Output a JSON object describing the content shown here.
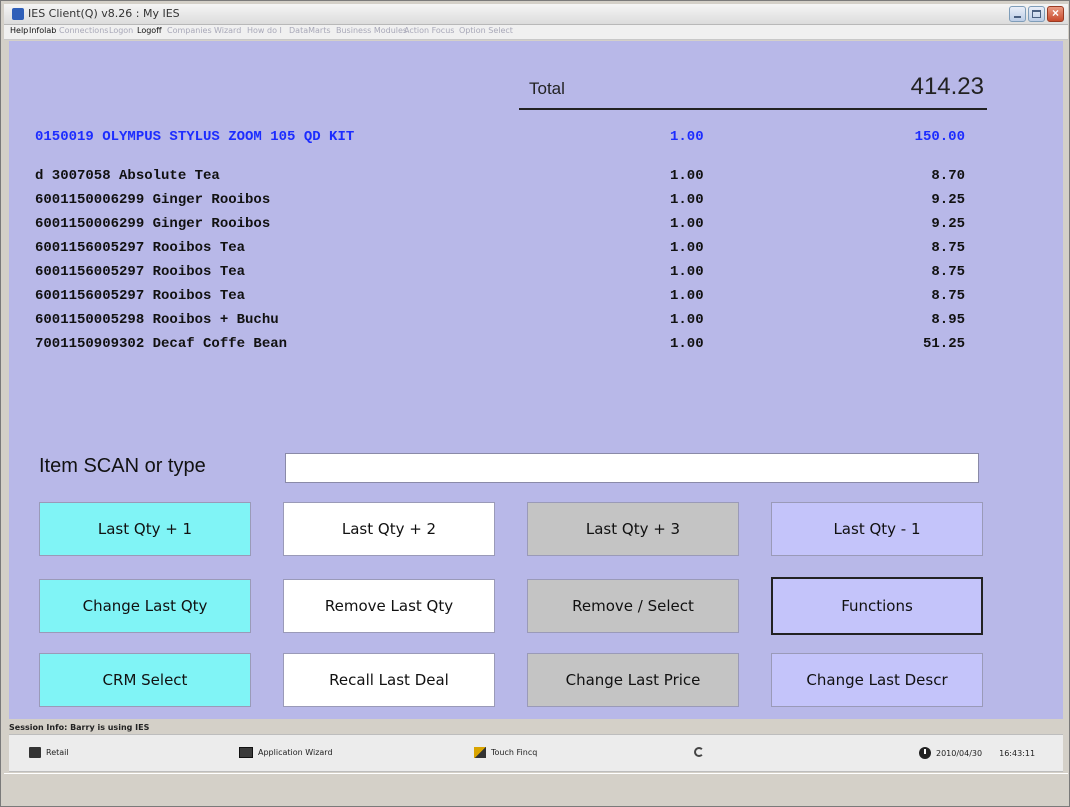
{
  "window": {
    "title": "IES Client(Q) v8.26 : My IES"
  },
  "menu": [
    {
      "label": "Help",
      "enabled": true
    },
    {
      "label": "Infolab",
      "enabled": true
    },
    {
      "label": "Connections",
      "enabled": false
    },
    {
      "label": "Logon",
      "enabled": false
    },
    {
      "label": "Logoff",
      "enabled": true
    },
    {
      "label": "Companies",
      "enabled": false
    },
    {
      "label": "Wizard",
      "enabled": false
    },
    {
      "label": "How do I",
      "enabled": false
    },
    {
      "label": "DataMarts",
      "enabled": false
    },
    {
      "label": "Business Modules",
      "enabled": false
    },
    {
      "label": "Action Focus",
      "enabled": false
    },
    {
      "label": "Option Select",
      "enabled": false
    }
  ],
  "pos": {
    "total_label": "Total",
    "total_value": "414.23",
    "lines": [
      {
        "desc": "0150019 OLYMPUS STYLUS ZOOM 105 QD KIT",
        "qty": "1.00",
        "amount": "150.00",
        "highlight": true
      },
      {
        "desc": "d 3007058 Absolute Tea",
        "qty": "1.00",
        "amount": "8.70"
      },
      {
        "desc": "6001150006299 Ginger Rooibos",
        "qty": "1.00",
        "amount": "9.25"
      },
      {
        "desc": "6001150006299 Ginger Rooibos",
        "qty": "1.00",
        "amount": "9.25"
      },
      {
        "desc": "6001156005297 Rooibos Tea",
        "qty": "1.00",
        "amount": "8.75"
      },
      {
        "desc": "6001156005297 Rooibos Tea",
        "qty": "1.00",
        "amount": "8.75"
      },
      {
        "desc": "6001156005297 Rooibos Tea",
        "qty": "1.00",
        "amount": "8.75"
      },
      {
        "desc": "6001150005298 Rooibos + Buchu",
        "qty": "1.00",
        "amount": "8.95"
      },
      {
        "desc": "7001150909302 Decaf Coffe Bean",
        "qty": "1.00",
        "amount": "51.25"
      }
    ],
    "scan_label": "Item SCAN or type",
    "scan_value": ""
  },
  "buttons": [
    {
      "label": "Last Qty + 1",
      "color": "cyan"
    },
    {
      "label": "Last Qty + 2",
      "color": "white"
    },
    {
      "label": "Last Qty + 3",
      "color": "gray"
    },
    {
      "label": "Last Qty - 1",
      "color": "lavender"
    },
    {
      "label": "Change Last Qty",
      "color": "cyan"
    },
    {
      "label": "Remove Last Qty",
      "color": "white"
    },
    {
      "label": "Remove / Select",
      "color": "gray"
    },
    {
      "label": "Functions",
      "color": "lavender"
    },
    {
      "label": "CRM Select",
      "color": "cyan"
    },
    {
      "label": "Recall Last Deal",
      "color": "white"
    },
    {
      "label": "Change Last Price",
      "color": "gray"
    },
    {
      "label": "Change Last Descr",
      "color": "lavender"
    }
  ],
  "status": {
    "session": "Session Info: Barry is using IES",
    "taskbar": [
      {
        "label": "Retail",
        "icon": "retail-icon"
      },
      {
        "label": "Application Wizard",
        "icon": "wizard-icon"
      },
      {
        "label": "Touch Fincq",
        "icon": "touch-icon"
      }
    ],
    "date": "2010/04/30",
    "time": "16:43:11"
  },
  "colors": {
    "panel": "#b8b8e8",
    "highlight_text": "#1c2cff",
    "cyan_button": "#80f4f6",
    "gray_button": "#c4c4c4",
    "lavender_button": "#c4c4fa"
  }
}
